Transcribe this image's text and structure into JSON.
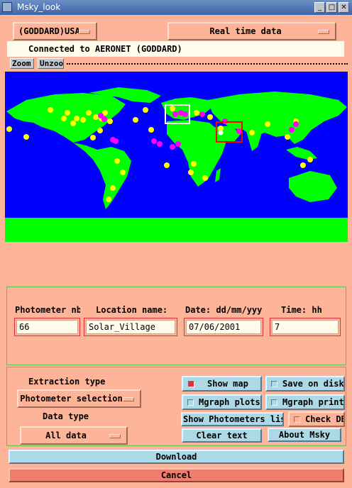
{
  "window": {
    "title": "Msky_look",
    "buttons": [
      "_",
      "□",
      "✕"
    ]
  },
  "top": {
    "network_menu": "(GODDARD)USA",
    "mode_menu": "Real time data",
    "status": "Connected to AERONET (GODDARD)",
    "zoom_label": "Zoom",
    "unzoom_label": "Unzoom"
  },
  "colors": {
    "ocean": "#0000ff",
    "land": "#00ff00",
    "site_yellow": "#ffff00",
    "site_magenta": "#ff00ff",
    "selection_red": "#ff0000"
  },
  "form": {
    "photometer_label": "Photometer nb",
    "location_label": "Location name:",
    "date_label": "Date: dd/mm/yyyy",
    "time_label": "Time: hh",
    "photometer_value": "66",
    "location_value": "Solar_Village",
    "date_value": "07/06/2001",
    "time_value": "7"
  },
  "controls": {
    "extraction_label": "Extraction type",
    "extraction_value": "Photometer selection",
    "data_type_label": "Data type",
    "data_type_value": "All data",
    "show_map": "Show map",
    "save_on_disk": "Save on disk",
    "mgraph_plots": "Mgraph plots",
    "mgraph_prints": "Mgraph prints",
    "show_photometers": "Show Photometers list",
    "check_db": "Check DB",
    "clear_text": "Clear text",
    "about": "About Msky"
  },
  "actions": {
    "download": "Download",
    "cancel": "Cancel"
  }
}
